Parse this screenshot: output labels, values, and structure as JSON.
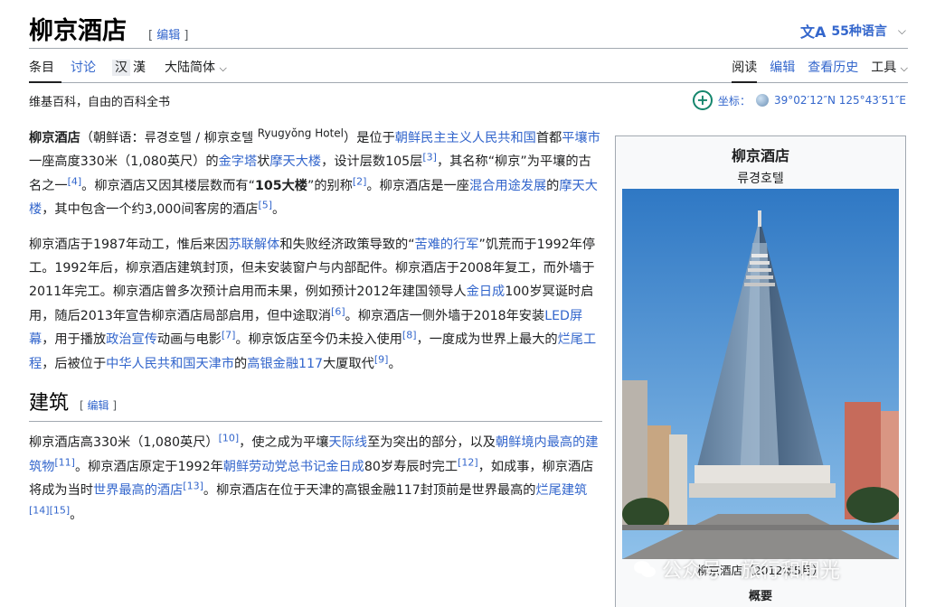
{
  "header": {
    "title": "柳京酒店",
    "edit_label": "编辑",
    "languages_label": "55种语言"
  },
  "tabs": {
    "article": "条目",
    "talk": "讨论",
    "variant_han": "汉",
    "variant_han_trad": "漢",
    "variant_select": "大陆简体",
    "read": "阅读",
    "edit": "编辑",
    "history": "查看历史",
    "tools": "工具"
  },
  "tagline": "维基百科，自由的百科全书",
  "coords": {
    "label": "坐标",
    "value": "39°02′12″N 125°43′51″E"
  },
  "article": {
    "p1": {
      "bold_name": "柳京酒店",
      "t1": "（朝鲜语：류경호텔 / 柳京호텔 ",
      "romanization": "Ryugyŏng Hotel",
      "t2": "）是位于",
      "l1": "朝鲜民主主义人民共和国",
      "t3": "首都",
      "l2": "平壤市",
      "t4": "一座高度330米（1,080英尺）的",
      "l3": "金字塔",
      "t5": "状",
      "l4": "摩天大楼",
      "t6": "，设计层数105层",
      "r1": "[3]",
      "t7": "，其名称“柳京”为平壤的古名之一",
      "r2": "[4]",
      "t8": "。柳京酒店又因其楼层数而有“",
      "nickname": "105大楼",
      "t9": "”的别称",
      "r3": "[2]",
      "t10": "。柳京酒店是一座",
      "l5": "混合用途发展",
      "t11": "的",
      "l6": "摩天大楼",
      "t12": "，其中包含一个约3,000间客房的酒店",
      "r4": "[5]",
      "t13": "。"
    },
    "p2": {
      "t1": "柳京酒店于1987年动工，惟后来因",
      "l1": "苏联解体",
      "t2": "和失败经济政策导致的“",
      "l2": "苦难的行军",
      "t3": "”饥荒而于1992年停工。1992年后，柳京酒店建筑封顶，但未安装窗户与内部配件。柳京酒店于2008年复工，而外墙于2011年完工。柳京酒店曾多次预计启用而未果，例如预计2012年建国领导人",
      "l3": "金日成",
      "t4": "100岁冥诞时启用，随后2013年宣告柳京酒店局部启用，但中途取消",
      "r1": "[6]",
      "t5": "。柳京酒店一侧外墙于2018年安装",
      "l4": "LED屏幕",
      "t6": "，用于播放",
      "l5": "政治宣传",
      "t7": "动画与电影",
      "r2": "[7]",
      "t8": "。柳京饭店至今仍未投入使用",
      "r3": "[8]",
      "t9": "，一度成为世界上最大的",
      "l6": "烂尾工程",
      "t10": "，后被位于",
      "l7": "中华人民共和国天津市",
      "t11": "的",
      "l8": "高银金融117",
      "t12": "大厦取代",
      "r4": "[9]",
      "t13": "。"
    },
    "section_title": "建筑",
    "section_edit": "编辑",
    "p3": {
      "t1": "柳京酒店高330米（1,080英尺）",
      "r1": "[10]",
      "t2": "，使之成为平壤",
      "l1": "天际线",
      "t3": "至为突出的部分，以及",
      "l2": "朝鲜境内最高的建筑物",
      "r2": "[11]",
      "t4": "。柳京酒店原定于1992年",
      "l3": "朝鲜劳动党总书记金日成",
      "t5": "80岁寿辰时完工",
      "r3": "[12]",
      "t6": "，如成事，柳京酒店将成为当时",
      "l4": "世界最高的酒店",
      "r4": "[13]",
      "t7": "。柳京酒店在位于天津的高银金融117封顶前是世界最高的",
      "l5": "烂尾建筑",
      "r5": "[14][15]",
      "t8": "。"
    }
  },
  "infobox": {
    "title": "柳京酒店",
    "subtitle": "류경호텔",
    "caption": "柳京酒店（2012年5月）",
    "summary": "概要"
  },
  "watermark": "公众号 · 旅行和阳光",
  "colors": {
    "link": "#3366cc",
    "text": "#202122",
    "border": "#a2a9b1",
    "infobox_bg": "#f8f9fa",
    "sky": "#4a8fd0",
    "tower_glass": "#6b86a4"
  },
  "icons": [
    "translate-icon",
    "chevron-down-icon",
    "add-circle-icon",
    "globe-icon",
    "wechat-icon"
  ]
}
